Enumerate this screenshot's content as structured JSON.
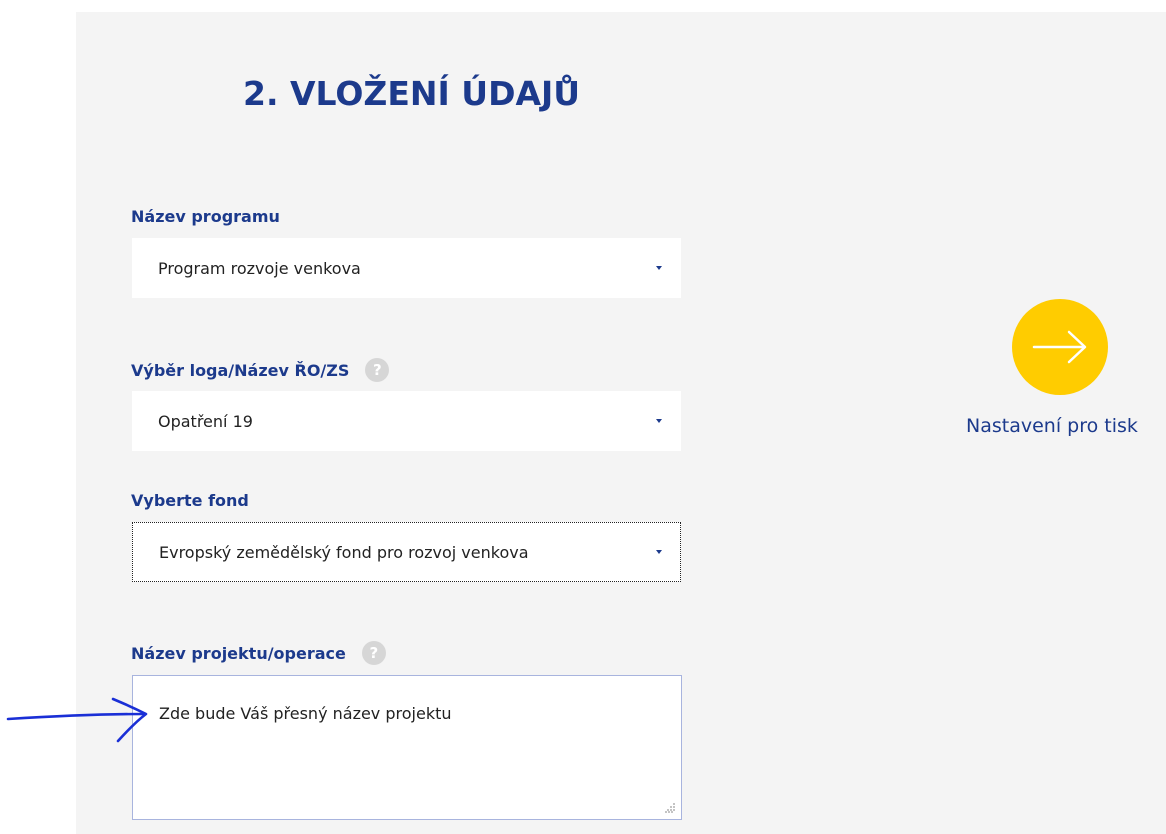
{
  "page": {
    "title": "2. VLOŽENÍ ÚDAJŮ"
  },
  "form": {
    "program": {
      "label": "Název programu",
      "value": "Program rozvoje venkova"
    },
    "logo": {
      "label": "Výběr loga/Název ŘO/ZS",
      "help": "?",
      "value": "Opatření 19"
    },
    "fund": {
      "label": "Vyberte fond",
      "value": "Evropský zemědělský fond pro rozvoj venkova"
    },
    "project": {
      "label": "Název projektu/operace",
      "help": "?",
      "value": "Zde bude Váš přesný název projektu"
    }
  },
  "next_step": {
    "label": "Nastavení pro tisk",
    "icon": "arrow-right-icon"
  },
  "colors": {
    "brand_blue": "#1c3a8c",
    "accent_yellow": "#ffcc00",
    "panel_background": "#f4f4f4",
    "annotation_blue": "#1a2fd6"
  }
}
